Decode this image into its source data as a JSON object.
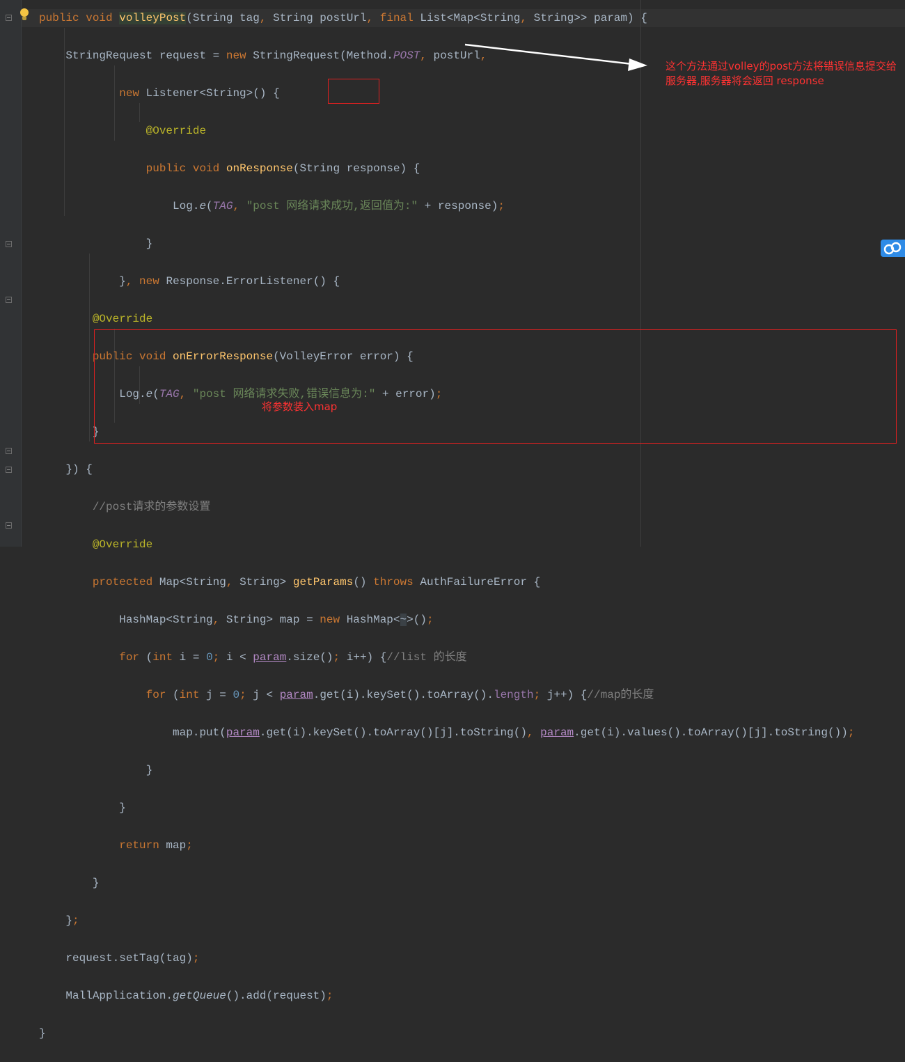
{
  "code_lines": [
    "public void volleyPost(String tag, String postUrl, final List<Map<String, String>> param) {",
    "    StringRequest request = new StringRequest(Method.POST, postUrl,",
    "            new Listener<String>() {",
    "                @Override",
    "                public void onResponse(String response) {",
    "                    Log.e(TAG, \"post 网络请求成功,返回值为:\" + response);",
    "                }",
    "            }, new Response.ErrorListener() {",
    "        @Override",
    "        public void onErrorResponse(VolleyError error) {",
    "            Log.e(TAG, \"post 网络请求失败,错误信息为:\" + error);",
    "        }",
    "    }) {",
    "        //post请求的参数设置",
    "        @Override",
    "        protected Map<String, String> getParams() throws AuthFailureError {",
    "            HashMap<String, String> map = new HashMap<~>();",
    "            for (int i = 0; i < param.size(); i++) {//list 的长度",
    "                for (int j = 0; j < param.get(i).keySet().toArray().length; j++) {//map的长度",
    "                    map.put(param.get(i).keySet().toArray()[j].toString(), param.get(i).values().toArray()[j].toString());",
    "                }",
    "            }",
    "            return map;",
    "        }",
    "    };",
    "    request.setTag(tag);",
    "    MallApplication.getQueue().add(request);",
    "}"
  ],
  "annotations": {
    "response_note": "这个方法通过volley的post方法将错误信息提交给服务器,服务器将会返回 response",
    "map_note": "将参数装入map"
  },
  "colors": {
    "editor_background": "#2b2b2b",
    "annotation_red": "#ff3232",
    "keyword": "#cc7832",
    "function": "#ffc66d",
    "string": "#6a8759"
  },
  "icons": [
    "lightbulb-icon",
    "fold-marker-icon",
    "cloud-sync-icon"
  ]
}
